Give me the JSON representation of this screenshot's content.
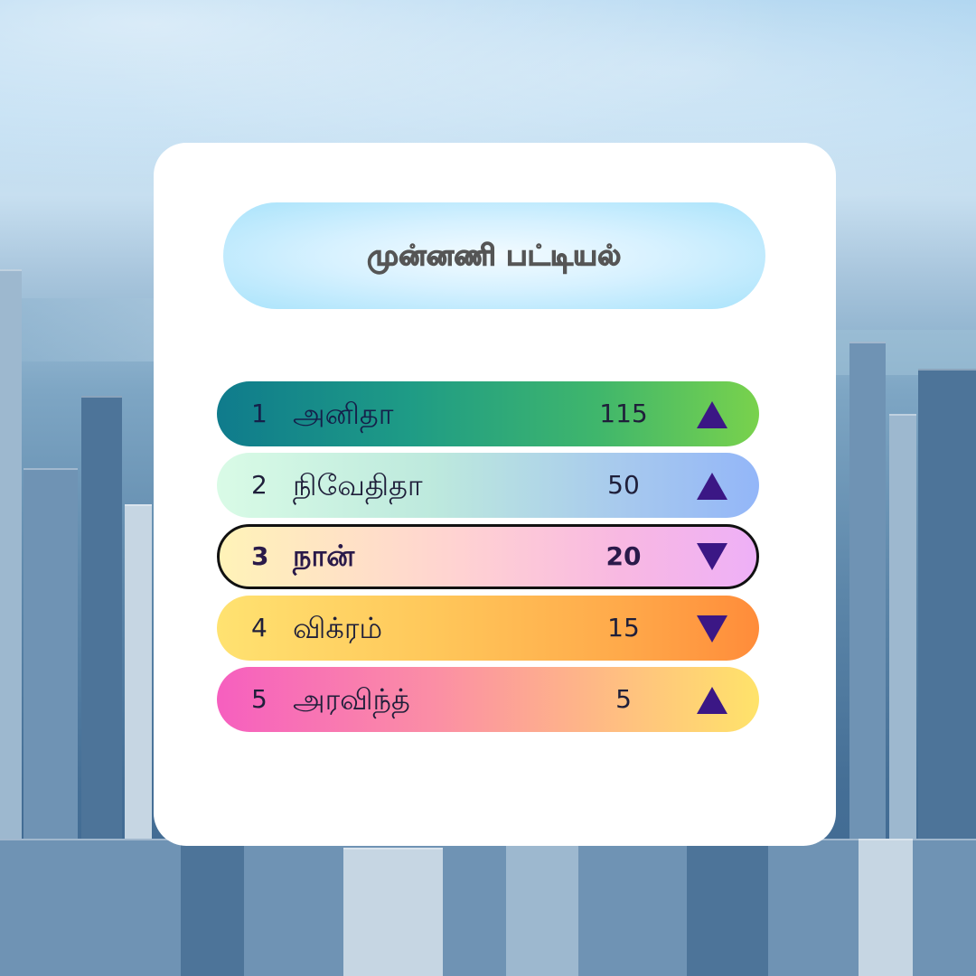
{
  "title": "முன்னணி பட்டியல்",
  "leaderboard": [
    {
      "rank": "1",
      "name": "அனிதா",
      "score": "115",
      "trend": "up"
    },
    {
      "rank": "2",
      "name": "நிவேதிதா",
      "score": "50",
      "trend": "up"
    },
    {
      "rank": "3",
      "name": "நான்",
      "score": "20",
      "trend": "down",
      "highlighted": true
    },
    {
      "rank": "4",
      "name": "விக்ரம்",
      "score": "15",
      "trend": "down"
    },
    {
      "rank": "5",
      "name": "அரவிந்த்",
      "score": "5",
      "trend": "up"
    }
  ],
  "icons": {
    "up": "triangle-up-icon",
    "down": "triangle-down-icon"
  },
  "colors": {
    "arrow": "#3b1785",
    "card": "#ffffff",
    "title_pill": "#a9e3fb"
  }
}
